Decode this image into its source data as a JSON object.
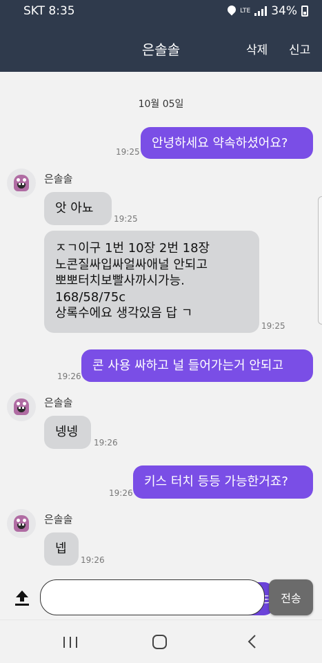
{
  "status_bar": {
    "carrier_time": "SKT 8:35",
    "network": "LTE",
    "battery": "34%"
  },
  "header": {
    "title": "은솔솔",
    "delete_label": "삭제",
    "report_label": "신고",
    "bg_color": "#2f3a4c"
  },
  "chat": {
    "date": "10월 05일",
    "messages": [
      {
        "direction": "out",
        "text": "안녕하세요 약속하셨어요?",
        "time": "19:25"
      },
      {
        "direction": "in",
        "sender": "은솔솔",
        "text": "앗 아뇨",
        "time": "19:25"
      },
      {
        "direction": "in",
        "text": "ㅈㄱ이구 1번 10장 2번 18장\n노콘질싸입싸얼싸애널 안되고\n뽀뽀터치보빨사까시가능.\n168/58/75c\n상록수에요 생각있음 답 ㄱ",
        "time": "19:25"
      },
      {
        "direction": "out",
        "text": "콘 사용 싸하고 널 들어가는거 안되고",
        "time": "19:26"
      },
      {
        "direction": "in",
        "sender": "은솔솔",
        "text": "넹넹",
        "time": "19:26"
      },
      {
        "direction": "out",
        "text": "키스 터치 등등 가능한거죠?",
        "time": "19:26"
      },
      {
        "direction": "in",
        "sender": "은솔솔",
        "text": "넵",
        "time": "19:26"
      }
    ],
    "outgoing_color": "#7a4ee6",
    "incoming_color": "#d5d6d8"
  },
  "input_bar": {
    "value": "",
    "peek_text": "터",
    "send_label": "전송"
  },
  "icons": {
    "upload": "upload-icon",
    "recent_apps": "recent-apps-icon",
    "home": "home-icon",
    "back": "back-icon"
  }
}
